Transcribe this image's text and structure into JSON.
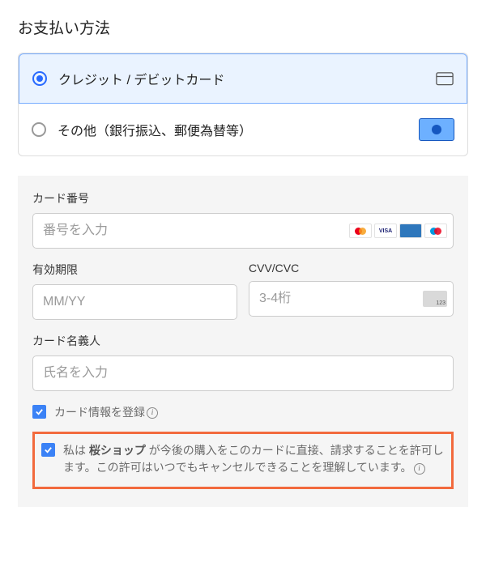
{
  "section_title": "お支払い方法",
  "payment_methods": {
    "card": "クレジット / デビットカード",
    "other": "その他（銀行振込、郵便為替等）"
  },
  "card_form": {
    "number_label": "カード番号",
    "number_placeholder": "番号を入力",
    "expiry_label": "有効期限",
    "expiry_placeholder": "MM/YY",
    "cvv_label": "CVV/CVC",
    "cvv_placeholder": "3-4桁",
    "cvv_badge": "123",
    "name_label": "カード名義人",
    "name_placeholder": "氏名を入力",
    "brands": {
      "visa": "VISA"
    }
  },
  "options": {
    "save_card": "カード情報を登録",
    "authorize_prefix": "私は ",
    "authorize_merchant": "桜ショップ",
    "authorize_suffix": " が今後の購入をこのカードに直接、請求することを許可します。この許可はいつでもキャンセルできることを理解しています。",
    "info_glyph": "i"
  }
}
